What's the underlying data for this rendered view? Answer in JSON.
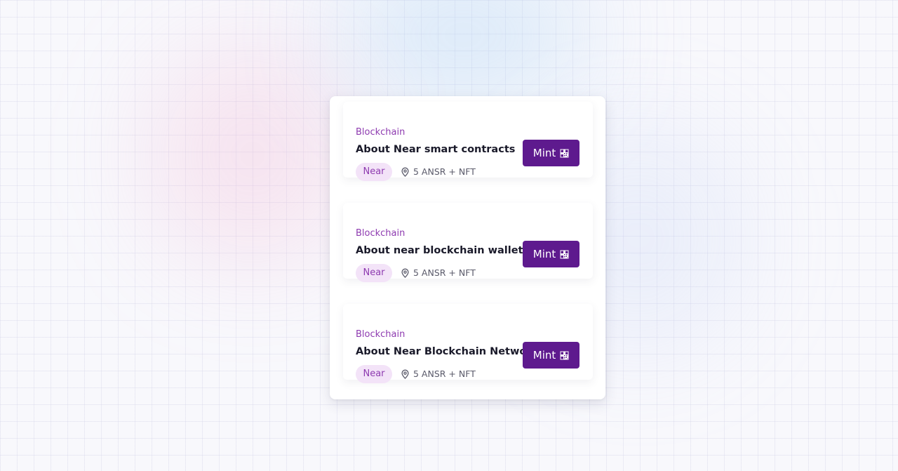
{
  "cards": [
    {
      "category": "Blockchain",
      "title": "About Near smart contracts",
      "tag": "Near",
      "reward": "5 ANSR + NFT",
      "action_label": "Mint",
      "action_icon": "qr-code-icon"
    },
    {
      "category": "Blockchain",
      "title": "About near blockchain wallets",
      "tag": "Near",
      "reward": "5 ANSR + NFT",
      "action_label": "Mint",
      "action_icon": "qr-code-icon"
    },
    {
      "category": "Blockchain",
      "title": "About Near Blockchain Network",
      "tag": "Near",
      "reward": "5 ANSR + NFT",
      "action_label": "Mint",
      "action_icon": "qr-code-icon"
    }
  ],
  "colors": {
    "accent": "#5e1a8e",
    "category_text": "#8e3bb0",
    "tag_background": "#f3e3f8",
    "title_text": "#1a1a2a"
  }
}
